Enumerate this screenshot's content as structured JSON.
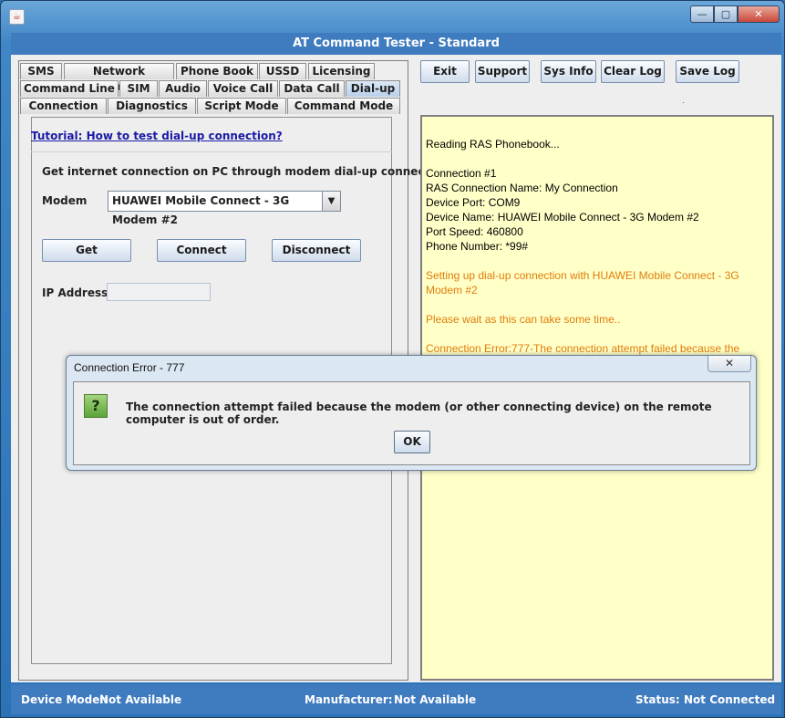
{
  "window": {
    "title": "AT Command Tester - Standard",
    "controls": {
      "minimize": "—",
      "maximize": "▢",
      "close": "✕"
    },
    "app_icon": "java-icon"
  },
  "tabs": {
    "row1": [
      "SMS",
      "Network Selection",
      "Phone Book",
      "USSD",
      "Licensing"
    ],
    "row2": [
      "Command Line",
      "SIM",
      "Audio",
      "Voice Call",
      "Data Call",
      "Dial-up"
    ],
    "row3": [
      "Connection",
      "Diagnostics",
      "Script Mode",
      "Command Mode"
    ],
    "selected": "Dial-up"
  },
  "dialup": {
    "tutorial_link": "Tutorial: How to test dial-up connection?",
    "description": "Get internet connection on PC through modem dial-up connection.",
    "modem_label": "Modem",
    "modem_value": "HUAWEI Mobile Connect - 3G Modem #2",
    "get_button": "Get",
    "connect_button": "Connect",
    "disconnect_button": "Disconnect",
    "ip_label": "IP Address",
    "ip_value": ""
  },
  "toolbar": {
    "exit": "Exit",
    "support": "Support",
    "sys_info": "Sys Info",
    "clear_log": "Clear Log",
    "save_log": "Save Log"
  },
  "log": {
    "lines": [
      {
        "text": "Reading RAS Phonebook...",
        "style": "normal"
      },
      {
        "text": "",
        "style": "normal"
      },
      {
        "text": "Connection #1",
        "style": "normal"
      },
      {
        "text": "RAS Connection Name: My Connection",
        "style": "normal"
      },
      {
        "text": "Device Port: COM9",
        "style": "normal"
      },
      {
        "text": "Device Name: HUAWEI Mobile Connect - 3G Modem #2",
        "style": "normal"
      },
      {
        "text": "Port Speed: 460800",
        "style": "normal"
      },
      {
        "text": "Phone Number: *99#",
        "style": "normal"
      },
      {
        "text": "",
        "style": "normal"
      },
      {
        "text": "Setting up dial-up connection with HUAWEI Mobile Connect - 3G",
        "style": "warn"
      },
      {
        "text": "Modem #2",
        "style": "warn"
      },
      {
        "text": "",
        "style": "normal"
      },
      {
        "text": "Please wait as this can take some time..",
        "style": "warn"
      },
      {
        "text": "",
        "style": "normal"
      },
      {
        "text": "Connection Error:777-The connection attempt failed because the",
        "style": "warn"
      }
    ]
  },
  "status": {
    "device_model_label": "Device Model:",
    "device_model_value": "Not Available",
    "manufacturer_label": "Manufacturer:",
    "manufacturer_value": "Not Available",
    "status_label": "Status:",
    "status_value": "Not Connected"
  },
  "dialog": {
    "title": "Connection Error - 777",
    "close_icon": "close-icon",
    "icon": "question-icon",
    "message": "The connection attempt failed because the modem (or other connecting device) on the remote computer is out of order.",
    "ok_button": "OK"
  },
  "colors": {
    "title_bar": "#3f7bbf",
    "log_background": "#ffffc8",
    "log_warning": "#e07d0c",
    "link": "#1a1aa6"
  }
}
